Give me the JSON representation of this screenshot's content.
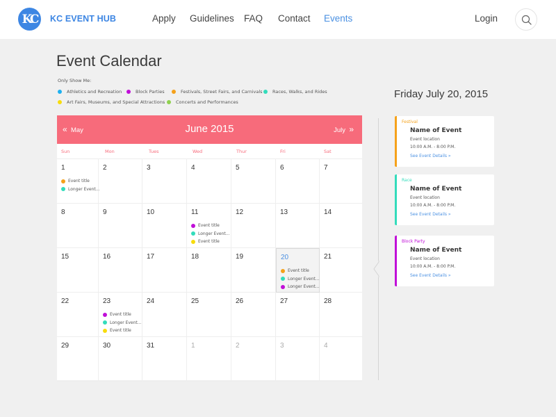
{
  "header": {
    "logo_text": "KC",
    "brand": "KC EVENT HUB",
    "nav": [
      {
        "label": "Apply",
        "active": false
      },
      {
        "label": "Guidelines",
        "active": false
      },
      {
        "label": "FAQ",
        "active": false
      },
      {
        "label": "Contact",
        "active": false
      },
      {
        "label": "Events",
        "active": true
      }
    ],
    "login": "Login",
    "search_icon": "search-icon"
  },
  "page_title": "Event Calendar",
  "filters": {
    "label": "Only Show Me:",
    "items": [
      {
        "label": "Athletics and Recreation",
        "color": "#1eb0f0"
      },
      {
        "label": "Block Parties",
        "color": "#c00fd8"
      },
      {
        "label": "Festivals, Street Fairs, and Carnivals",
        "color": "#f5a11a"
      },
      {
        "label": "Races, Walks, and Rides",
        "color": "#33dcbb"
      },
      {
        "label": "Art Fairs, Museums, and Special Attractions",
        "color": "#f7dc0d"
      },
      {
        "label": "Concerts and Performances",
        "color": "#8fd14f"
      }
    ]
  },
  "calendar": {
    "prev_label": "May",
    "next_label": "July",
    "title": "June 2015",
    "accent": "#f76b7b",
    "weekdays": [
      "Sun",
      "Mon",
      "Tues",
      "Wed",
      "Thur",
      "Fri",
      "Sat"
    ],
    "weeks": [
      [
        {
          "day": "1",
          "events": [
            {
              "title": "Event title",
              "color": "#f5a11a"
            },
            {
              "title": "Longer Event...",
              "color": "#33dcbb"
            }
          ]
        },
        {
          "day": "2",
          "events": []
        },
        {
          "day": "3",
          "events": []
        },
        {
          "day": "4",
          "events": []
        },
        {
          "day": "5",
          "events": []
        },
        {
          "day": "6",
          "events": []
        },
        {
          "day": "7",
          "events": []
        }
      ],
      [
        {
          "day": "8",
          "events": []
        },
        {
          "day": "9",
          "events": []
        },
        {
          "day": "10",
          "events": []
        },
        {
          "day": "11",
          "events": [
            {
              "title": "Event title",
              "color": "#c00fd8"
            },
            {
              "title": "Longer Event...",
              "color": "#33dcbb"
            },
            {
              "title": "Event title",
              "color": "#f7dc0d"
            }
          ]
        },
        {
          "day": "12",
          "events": []
        },
        {
          "day": "13",
          "events": []
        },
        {
          "day": "14",
          "events": []
        }
      ],
      [
        {
          "day": "15",
          "events": []
        },
        {
          "day": "16",
          "events": []
        },
        {
          "day": "17",
          "events": []
        },
        {
          "day": "18",
          "events": []
        },
        {
          "day": "19",
          "events": []
        },
        {
          "day": "20",
          "selected": true,
          "events": [
            {
              "title": "Event title",
              "color": "#f5a11a"
            },
            {
              "title": "Longer Event...",
              "color": "#33dcbb"
            },
            {
              "title": "Longer Event...",
              "color": "#c00fd8"
            }
          ]
        },
        {
          "day": "21",
          "events": []
        }
      ],
      [
        {
          "day": "22",
          "events": []
        },
        {
          "day": "23",
          "events": [
            {
              "title": "Event title",
              "color": "#c00fd8"
            },
            {
              "title": "Longer Event...",
              "color": "#33dcbb"
            },
            {
              "title": "Event title",
              "color": "#f7dc0d"
            }
          ]
        },
        {
          "day": "24",
          "events": []
        },
        {
          "day": "25",
          "events": []
        },
        {
          "day": "26",
          "events": []
        },
        {
          "day": "27",
          "events": []
        },
        {
          "day": "28",
          "events": []
        }
      ],
      [
        {
          "day": "29",
          "events": []
        },
        {
          "day": "30",
          "events": []
        },
        {
          "day": "31",
          "events": []
        },
        {
          "day": "1",
          "other": true,
          "events": []
        },
        {
          "day": "2",
          "other": true,
          "events": []
        },
        {
          "day": "3",
          "other": true,
          "events": []
        },
        {
          "day": "4",
          "other": true,
          "events": []
        }
      ]
    ]
  },
  "day_panel": {
    "title": "Friday July 20, 2015",
    "cards": [
      {
        "category": "Festival",
        "color": "#f5a11a",
        "name": "Name of Event",
        "location": "Event location",
        "time": "10:00 A.M. - 8:00 P.M.",
        "link": "See Event Details »"
      },
      {
        "category": "Race",
        "color": "#33dcbb",
        "name": "Name of Event",
        "location": "Event location",
        "time": "10:00 A.M. - 8:00 P.M.",
        "link": "See Event Details »"
      },
      {
        "category": "Block Party",
        "color": "#c00fd8",
        "name": "Name of Event",
        "location": "Event location",
        "time": "10:00 A.M. - 8:00 P.M.",
        "link": "See Event Details »"
      }
    ]
  }
}
